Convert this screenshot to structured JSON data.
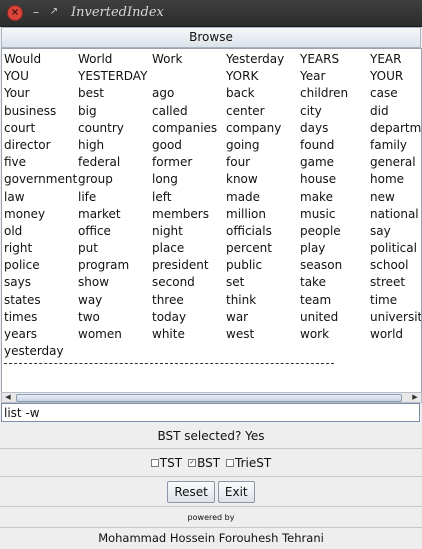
{
  "window": {
    "title": "InvertedIndex"
  },
  "browse_label": "Browse",
  "words": [
    [
      "Would",
      "World",
      "Work",
      "Yesterday",
      "YEARS",
      "YEAR"
    ],
    [
      "YOU",
      "YESTERDAY",
      "",
      "YORK",
      "Year",
      " YOUR"
    ],
    [
      "Your",
      "best",
      "ago",
      "back",
      "children",
      "case"
    ],
    [
      "business",
      "big",
      "called",
      "center",
      "city",
      "did"
    ],
    [
      "court",
      "country",
      "companies",
      "company",
      "days",
      "departm"
    ],
    [
      "director",
      "high",
      "good",
      "going",
      "found",
      "family"
    ],
    [
      "five",
      "federal",
      "former",
      "four",
      "game",
      "general"
    ],
    [
      "government",
      "group",
      "long",
      "know",
      "house",
      "home"
    ],
    [
      "law",
      "life",
      "left",
      "made",
      "make",
      "new"
    ],
    [
      "money",
      "market",
      "members",
      "million",
      "music",
      "national"
    ],
    [
      "old",
      "office",
      "night",
      "officials",
      "people",
      "say"
    ],
    [
      "right",
      "put",
      "place",
      "percent",
      "play",
      "political"
    ],
    [
      "police",
      "program",
      "president",
      "public",
      "season",
      "school"
    ],
    [
      "says",
      "show",
      "second",
      "set",
      "take",
      "street"
    ],
    [
      "states",
      "way",
      "three",
      "think",
      "team",
      "time"
    ],
    [
      "times",
      "two",
      "today",
      "war",
      "united",
      "universit"
    ],
    [
      "years",
      "women",
      "white",
      "west",
      "work",
      "world"
    ],
    [
      "yesterday",
      "",
      "",
      "",
      "",
      ""
    ]
  ],
  "command_value": "list -w",
  "status_text": "BST selected? Yes",
  "options": [
    {
      "label": "TST",
      "checked": false
    },
    {
      "label": "BST",
      "checked": true
    },
    {
      "label": "TrieST",
      "checked": false
    }
  ],
  "buttons": {
    "reset": "Reset",
    "exit": "Exit"
  },
  "powered_by": "powered by",
  "author": "Mohammad Hossein Forouhesh Tehrani"
}
